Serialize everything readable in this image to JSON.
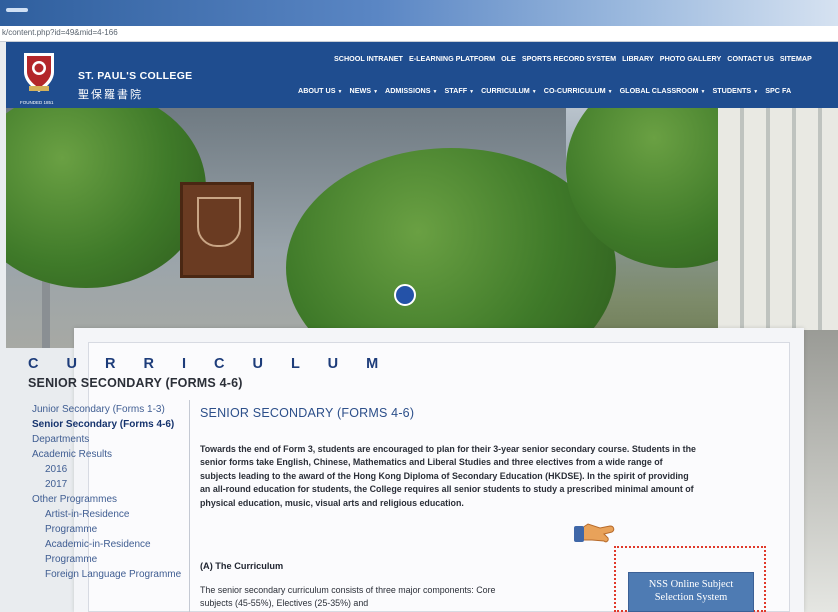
{
  "browser": {
    "url_fragment": "k/content.php?id=49&mid=4-166"
  },
  "site": {
    "name_en": "ST. PAUL'S COLLEGE",
    "name_zh": "聖保羅書院",
    "founded": "FOUNDED 1851",
    "colors": {
      "header": "#1f4d8f",
      "accent": "#4e7bb3",
      "highlight": "#e0392a"
    }
  },
  "top_nav": [
    "SCHOOL INTRANET",
    "E-LEARNING PLATFORM",
    "OLE",
    "SPORTS RECORD SYSTEM",
    "LIBRARY",
    "PHOTO GALLERY",
    "CONTACT US",
    "SITEMAP"
  ],
  "main_nav": [
    "ABOUT US",
    "NEWS",
    "ADMISSIONS",
    "STAFF",
    "CURRICULUM",
    "CO-CURRICULUM",
    "GLOBAL CLASSROOM",
    "STUDENTS",
    "SPC FA"
  ],
  "page": {
    "section_title": "C U R R I C U L U M",
    "subtitle": "SENIOR SECONDARY (FORMS 4-6)",
    "heading": "SENIOR SECONDARY (FORMS 4-6)",
    "intro": "Towards the end of Form 3, students are encouraged to plan for their 3-year senior secondary course. Students in the senior forms take English, Chinese, Mathematics and Liberal Studies and three electives from a wide range of subjects leading to the award of the Hong Kong Diploma of Secondary Education (HKDSE).  In the spirit of providing an all-round education for students, the College requires all senior students to study a prescribed minimal amount of physical education, music, visual arts and religious education.",
    "section_a": "(A)  The Curriculum",
    "section_a_body": "The senior secondary curriculum consists of three major components: Core subjects (45-55%), Electives (25-35%) and"
  },
  "sidebar": [
    {
      "label": "Junior Secondary (Forms 1-3)",
      "level": 1,
      "active": false
    },
    {
      "label": "Senior Secondary (Forms 4-6)",
      "level": 1,
      "active": true
    },
    {
      "label": "Departments",
      "level": 1,
      "active": false
    },
    {
      "label": "Academic Results",
      "level": 1,
      "active": false
    },
    {
      "label": "2016",
      "level": 2,
      "active": false
    },
    {
      "label": "2017",
      "level": 2,
      "active": false
    },
    {
      "label": "Other Programmes",
      "level": 1,
      "active": false
    },
    {
      "label": "Artist-in-Residence Programme",
      "level": 2,
      "active": false
    },
    {
      "label": "Academic-in-Residence Programme",
      "level": 2,
      "active": false
    },
    {
      "label": "Foreign Language Programme",
      "level": 2,
      "active": false
    }
  ],
  "nss_button": {
    "line1": "NSS Online Subject",
    "line2": "Selection System"
  }
}
